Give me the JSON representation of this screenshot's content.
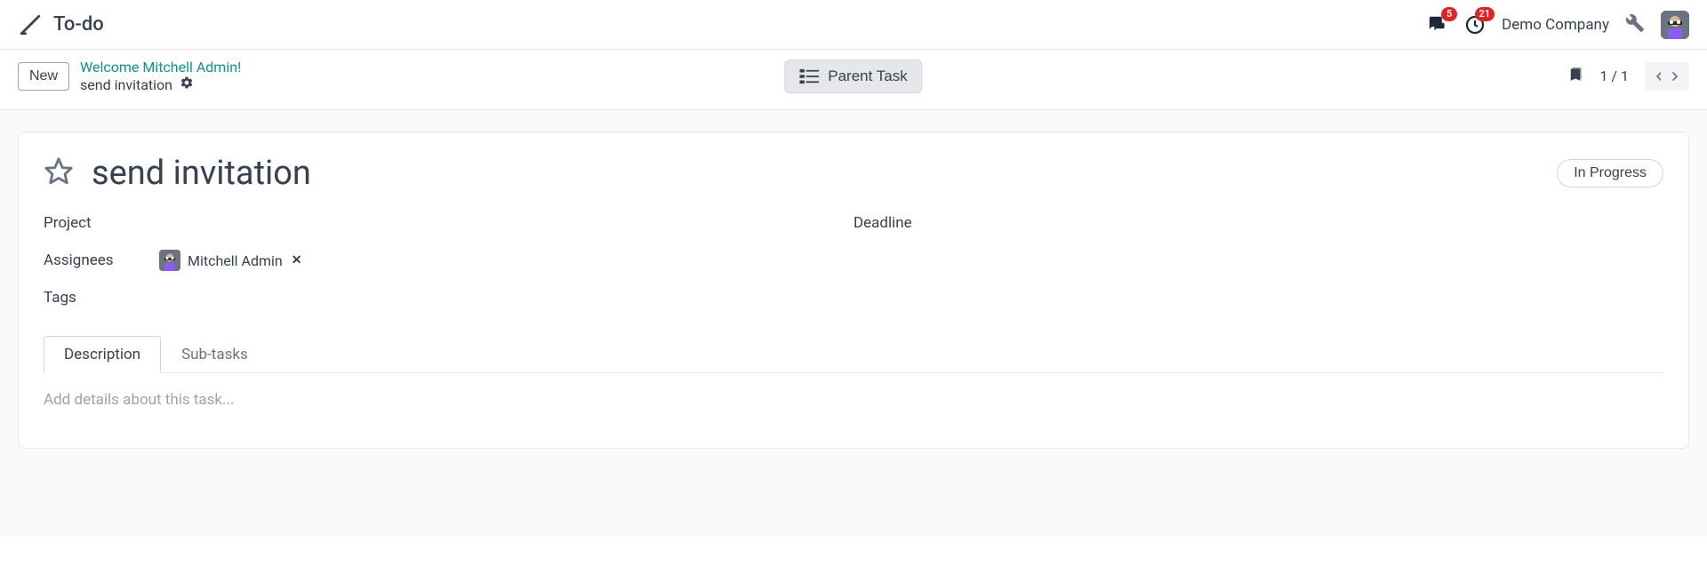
{
  "header": {
    "app_title": "To-do",
    "messages_badge": "5",
    "activities_badge": "21",
    "company_name": "Demo Company"
  },
  "subheader": {
    "new_button": "New",
    "breadcrumb_parent": "Welcome Mitchell Admin!",
    "breadcrumb_current": "send invitation",
    "parent_task_button": "Parent Task",
    "pager": "1 / 1"
  },
  "task": {
    "title": "send invitation",
    "status": "In Progress",
    "fields": {
      "project_label": "Project",
      "deadline_label": "Deadline",
      "assignees_label": "Assignees",
      "tags_label": "Tags"
    },
    "assignee": {
      "name": "Mitchell Admin"
    },
    "tabs": {
      "description": "Description",
      "subtasks": "Sub-tasks"
    },
    "description_placeholder": "Add details about this task..."
  }
}
